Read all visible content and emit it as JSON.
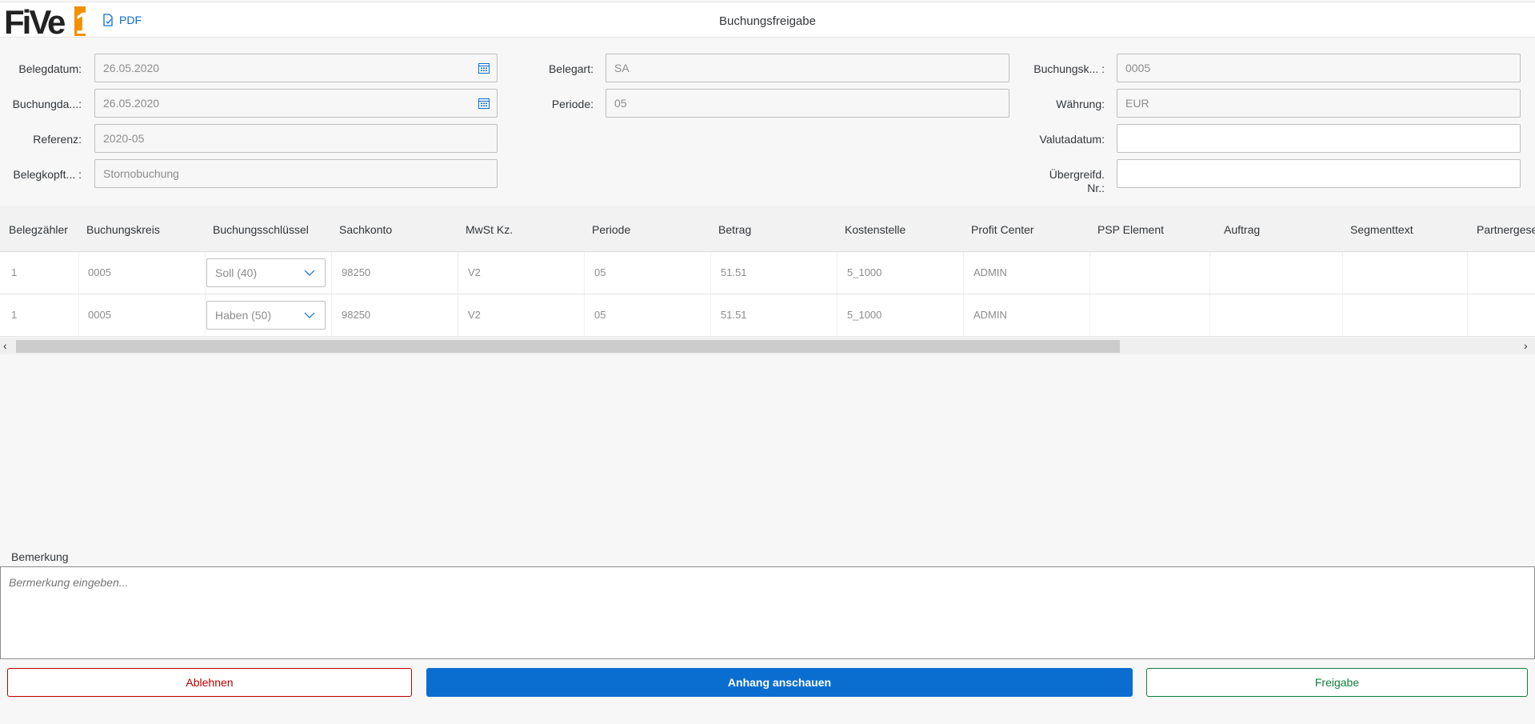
{
  "header": {
    "logo_text": "FiVe1",
    "pdf_label": "PDF",
    "title": "Buchungsfreigabe"
  },
  "form": {
    "belegdatum": {
      "label": "Belegdatum:",
      "value": "26.05.2020"
    },
    "buchungsdatum": {
      "label": "Buchungda...:",
      "value": "26.05.2020"
    },
    "referenz": {
      "label": "Referenz:",
      "value": "2020-05"
    },
    "belegkopftext": {
      "label": "Belegkopft... :",
      "value": "Stornobuchung"
    },
    "belegart": {
      "label": "Belegart:",
      "value": "SA"
    },
    "periode": {
      "label": "Periode:",
      "value": "05"
    },
    "buchungskreis": {
      "label": "Buchungsk... :",
      "value": "0005"
    },
    "waehrung": {
      "label": "Währung:",
      "value": "EUR"
    },
    "valutadatum": {
      "label": "Valutadatum:",
      "value": ""
    },
    "uebergreifd_line1": "Übergreifd.",
    "uebergreifd_line2": "Nr.:",
    "uebergreifd_value": ""
  },
  "table": {
    "columns": [
      "Belegzähler",
      "Buchungskreis",
      "Buchungsschlüssel",
      "Sachkonto",
      "MwSt Kz.",
      "Periode",
      "Betrag",
      "Kostenstelle",
      "Profit Center",
      "PSP Element",
      "Auftrag",
      "Segmenttext",
      "Partnergese"
    ],
    "rows": [
      {
        "belegzaehler": "1",
        "buchungskreis": "0005",
        "buchungsschluessel": "Soll (40)",
        "sachkonto": "98250",
        "mwst": "V2",
        "periode": "05",
        "betrag": "51.51",
        "kostenstelle": "5_1000",
        "profit_center": "ADMIN",
        "psp": "",
        "auftrag": "",
        "segmenttext": "",
        "partner": ""
      },
      {
        "belegzaehler": "1",
        "buchungskreis": "0005",
        "buchungsschluessel": "Haben (50)",
        "sachkonto": "98250",
        "mwst": "V2",
        "periode": "05",
        "betrag": "51.51",
        "kostenstelle": "5_1000",
        "profit_center": "ADMIN",
        "psp": "",
        "auftrag": "",
        "segmenttext": "",
        "partner": ""
      }
    ]
  },
  "remark": {
    "label": "Bemerkung",
    "placeholder": "Bermerkung eingeben..."
  },
  "buttons": {
    "reject": "Ablehnen",
    "attachment": "Anhang anschauen",
    "approve": "Freigabe"
  },
  "colors": {
    "accent": "#0a6ed1",
    "reject": "#bb0000",
    "approve": "#107e3e",
    "logo_orange": "#f29100"
  },
  "icons": [
    "pdf-document-icon",
    "calendar-icon",
    "chevron-down-icon",
    "scroll-left-icon",
    "scroll-right-icon"
  ]
}
